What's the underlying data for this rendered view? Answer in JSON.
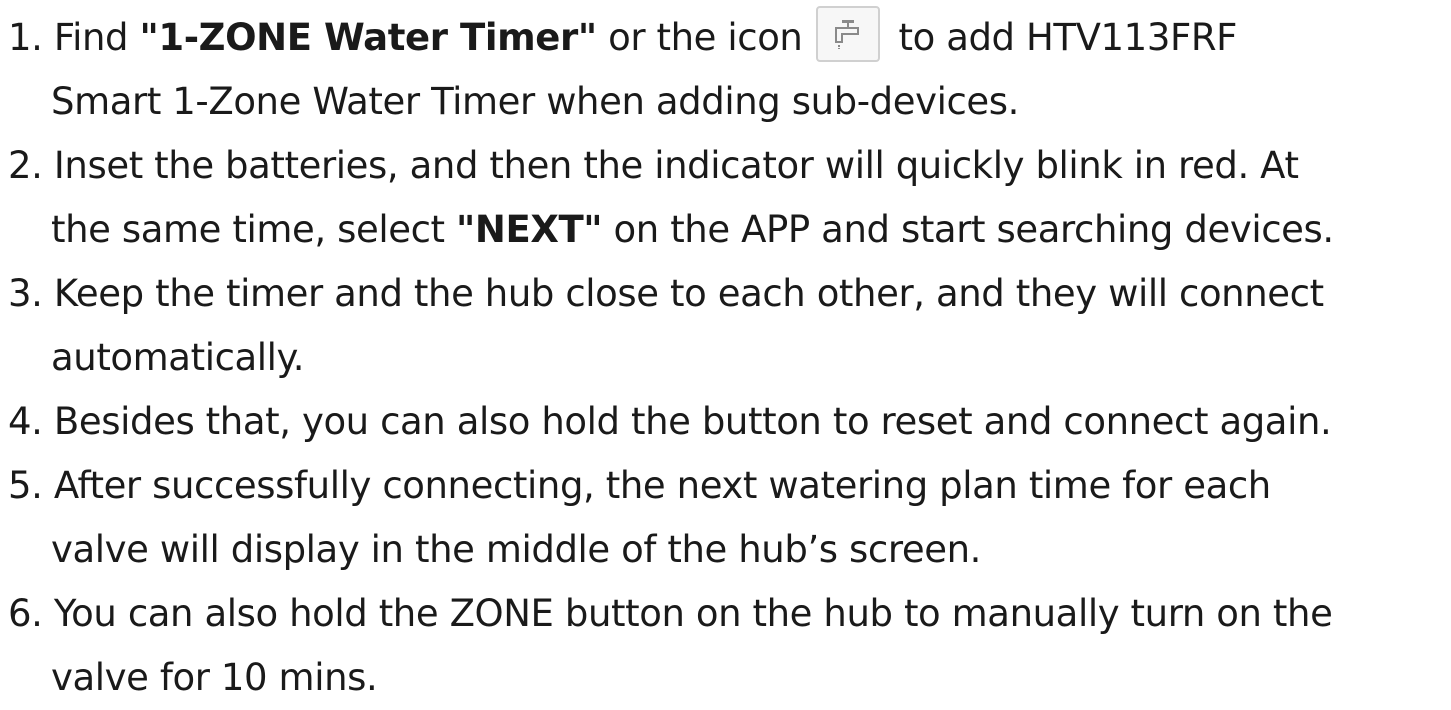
{
  "steps": [
    {
      "num": "1.",
      "before_bold": "Find ",
      "bold": "\"1-ZONE Water Timer\"",
      "after_bold": " or the icon",
      "icon": "faucet-icon",
      "line1_end": "to add HTV113FRF",
      "line2": "Smart 1-Zone Water Timer when adding sub-devices."
    },
    {
      "num": "2.",
      "line1": "Inset the batteries, and then the indicator will quickly blink in red. At",
      "line2_before": "the same time, select ",
      "line2_bold": "\"NEXT\"",
      "line2_after": " on the APP and start searching devices."
    },
    {
      "num": "3.",
      "line1": "Keep the timer and the hub close to each other, and they will connect",
      "line2": "automatically."
    },
    {
      "num": "4.",
      "line1": "Besides that, you can also hold the button to reset and connect again."
    },
    {
      "num": "5.",
      "line1": "After successfully connecting, the next watering plan time for each",
      "line2": "valve will display in the middle of the hub’s screen."
    },
    {
      "num": "6.",
      "line1": "You can also hold the ZONE button on the hub to manually turn on the",
      "line2": "valve for 10 mins."
    }
  ]
}
